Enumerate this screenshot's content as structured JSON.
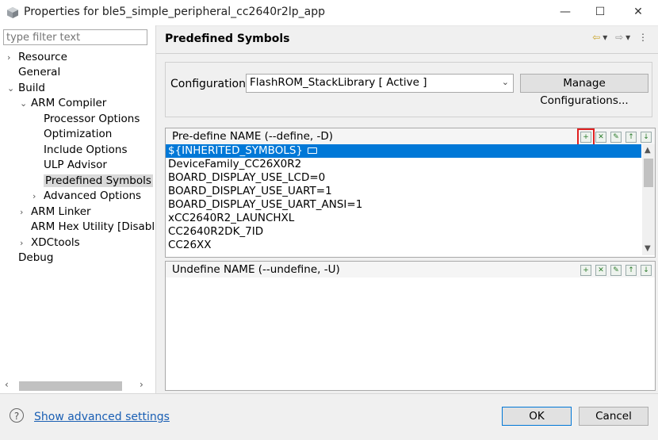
{
  "window": {
    "title": "Properties for ble5_simple_peripheral_cc2640r2lp_app",
    "minimize": "—",
    "maximize": "☐",
    "close": "✕"
  },
  "sidebar": {
    "filter_placeholder": "type filter text",
    "items": [
      {
        "label": "Resource",
        "chevron": "›"
      },
      {
        "label": "General",
        "chevron": ""
      },
      {
        "label": "Build",
        "chevron": "⌄"
      },
      {
        "label": "ARM Compiler",
        "chevron": "⌄"
      },
      {
        "label": "Processor Options",
        "chevron": ""
      },
      {
        "label": "Optimization",
        "chevron": ""
      },
      {
        "label": "Include Options",
        "chevron": ""
      },
      {
        "label": "ULP Advisor",
        "chevron": ""
      },
      {
        "label": "Predefined Symbols",
        "chevron": ""
      },
      {
        "label": "Advanced Options",
        "chevron": "›"
      },
      {
        "label": "ARM Linker",
        "chevron": "›"
      },
      {
        "label": "ARM Hex Utility  [Disabl",
        "chevron": ""
      },
      {
        "label": "XDCtools",
        "chevron": "›"
      },
      {
        "label": "Debug",
        "chevron": ""
      }
    ]
  },
  "main": {
    "title": "Predefined Symbols",
    "configuration_label": "Configuration:",
    "configuration_value": "FlashROM_StackLibrary  [ Active ]",
    "manage_button": "Manage Configurations..."
  },
  "predefine": {
    "title": "Pre-define NAME (--define, -D)",
    "items": [
      "${INHERITED_SYMBOLS}",
      "DeviceFamily_CC26X0R2",
      "BOARD_DISPLAY_USE_LCD=0",
      "BOARD_DISPLAY_USE_UART=1",
      "BOARD_DISPLAY_USE_UART_ANSI=1",
      "xCC2640R2_LAUNCHXL",
      "CC2640R2DK_7ID",
      "CC26XX"
    ]
  },
  "undefine": {
    "title": "Undefine NAME (--undefine, -U)"
  },
  "footer": {
    "help": "?",
    "advanced_link": "Show advanced settings",
    "ok": "OK",
    "cancel": "Cancel"
  }
}
